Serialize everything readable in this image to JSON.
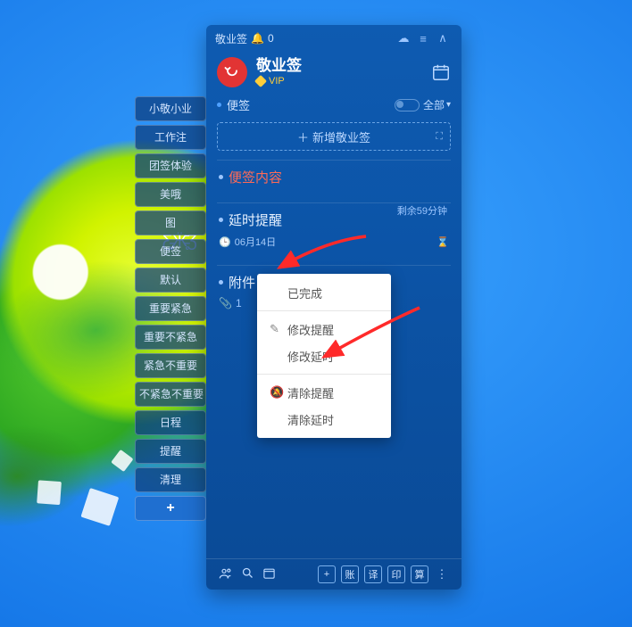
{
  "titlebar": {
    "app": "敬业签",
    "bell_count": "0"
  },
  "header": {
    "app_name": "敬业签",
    "vip": "VIP"
  },
  "filter": {
    "label": "便签",
    "scope": "全部"
  },
  "addnew": {
    "label": "新增敬业签"
  },
  "cards": [
    {
      "title": "便签内容"
    },
    {
      "title": "延时提醒",
      "remaining": "剩余59分钟",
      "date": "06月14日"
    },
    {
      "title": "附件",
      "attach_count": "1"
    }
  ],
  "footer_sq": [
    "+",
    "账",
    "译",
    "印",
    "算"
  ],
  "sidebar_tabs": [
    "小敬小业",
    "工作注",
    "团签体验",
    "美哦",
    "图",
    "便签",
    "默认",
    "重要紧急",
    "重要不紧急",
    "紧急不重要",
    "不紧急不重要",
    "日程",
    "提醒",
    "清理"
  ],
  "context_menu": {
    "completed": "已完成",
    "edit_remind": "修改提醒",
    "edit_delay": "修改延时",
    "clear_remind": "清除提醒",
    "clear_delay": "清除延时"
  }
}
